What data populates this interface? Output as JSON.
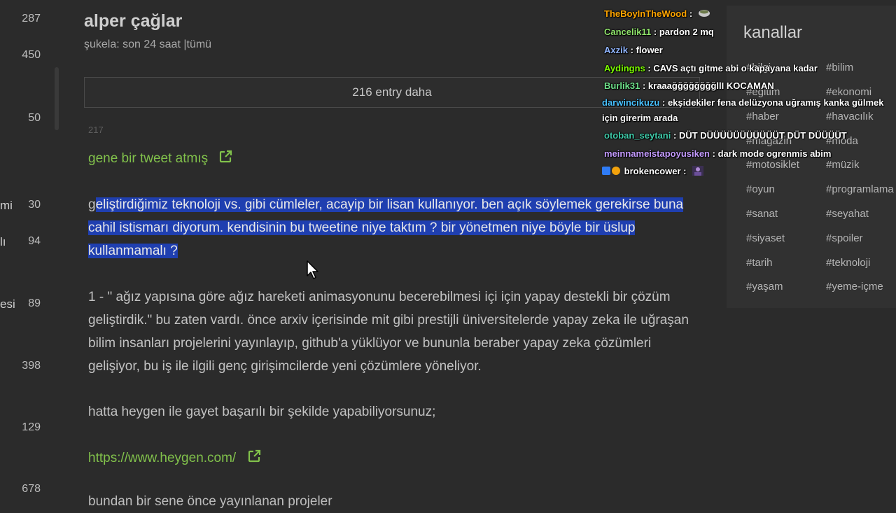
{
  "left_sidebar": {
    "items": [
      {
        "cut": "",
        "count": "287"
      },
      {
        "cut": "",
        "count": "450"
      },
      {
        "cut": "",
        "count": "50"
      },
      {
        "cut": "mi",
        "count": "30"
      },
      {
        "cut": "lı",
        "count": "94"
      },
      {
        "cut": "esi",
        "count": "89"
      },
      {
        "cut": "",
        "count": "398"
      },
      {
        "cut": "",
        "count": "129"
      },
      {
        "cut": "",
        "count": "678"
      }
    ]
  },
  "topic": {
    "title": "alper çağlar",
    "filter_label": "şukela:",
    "filter_period": "son 24 saat",
    "filter_sep": "|",
    "filter_all": "tümü",
    "more_entries": "216 entry daha",
    "entry_number": "217"
  },
  "entry": {
    "tweet_link": "gene bir tweet atmış",
    "selected_first_char": "g",
    "selected_text": "eliştirdiğimiz teknoloji vs. gibi cümleler, acayip bir lisan kullanıyor. ben açık söylemek gerekirse buna cahil istismarı diyorum. kendisinin bu tweetine niye taktım ? bir yönetmen niye böyle bir üslup kullanmamalı ?",
    "para1": "1 - \" ağız yapısına göre ağız hareketi animasyonunu becerebilmesi içi için yapay destekli bir çözüm geliştirdik.\" bu zaten vardı. önce arxiv içerisinde mit gibi prestijli üniversitelerde yapay zeka ile uğraşan bilim insanları projelerini yayınlayıp, github'a yüklüyor ve bununla beraber yapay zeka çözümleri gelişiyor, bu iş ile ilgili genç girişimcilerde yeni çözümlere yöneliyor.",
    "para2": "hatta heygen ile gayet başarılı bir şekilde yapabiliyorsunuz;",
    "heygen_link": "https://www.heygen.com/",
    "para4": "bundan bir sene önce yayınlanan projeler"
  },
  "channels": {
    "title": "kanallar",
    "left": [
      "#bilgi",
      "#eğitim",
      "#haber",
      "#magazin",
      "#motosiklet",
      "#oyun",
      "#sanat",
      "#siyaset",
      "#tarih",
      "#yaşam"
    ],
    "right": [
      "#bilim",
      "#ekonomi",
      "#havacılık",
      "#moda",
      "#müzik",
      "#programlama",
      "#seyahat",
      "#spoiler",
      "#teknoloji",
      "#yeme-içme"
    ]
  },
  "chat": {
    "messages": [
      {
        "user": "TheBoyInTheWood",
        "color": "#ffa500",
        "text": ""
      },
      {
        "user": "Cancelik11",
        "color": "#8fe36b",
        "text": "pardon 2 mq"
      },
      {
        "user": "Axzik",
        "color": "#8fb4ff",
        "text": "flower"
      },
      {
        "user": "Aydingns",
        "color": "#7cfc00",
        "text": "CAVS açtı gitme abi o kapayana kadar"
      },
      {
        "user": "Burlik31",
        "color": "#6ee08a",
        "text": "kraaağğğğğğğğllI KOCAMAN"
      },
      {
        "user": "darwincikuzu",
        "color": "#48c1ff",
        "text": "ekşidekiler fena delüzyona uğramış kanka gülmek için girerim arada"
      },
      {
        "user": "otoban_seytani",
        "color": "#3fc9a8",
        "text": "DÜT DÜÜÜÜÜÜÜÜÜÜÜT DÜT DÜÜÜÜT"
      },
      {
        "user": "meinnameistapoyusiken",
        "color": "#c49bff",
        "text": "dark mode ogrenmis abim"
      },
      {
        "user": "brokencower",
        "color": "#ffffff",
        "text": ""
      }
    ],
    "sep": ":"
  },
  "colors": {
    "background": "#2b2b2b",
    "link_green": "#81c14b",
    "selection_blue": "#1f3fb0"
  }
}
